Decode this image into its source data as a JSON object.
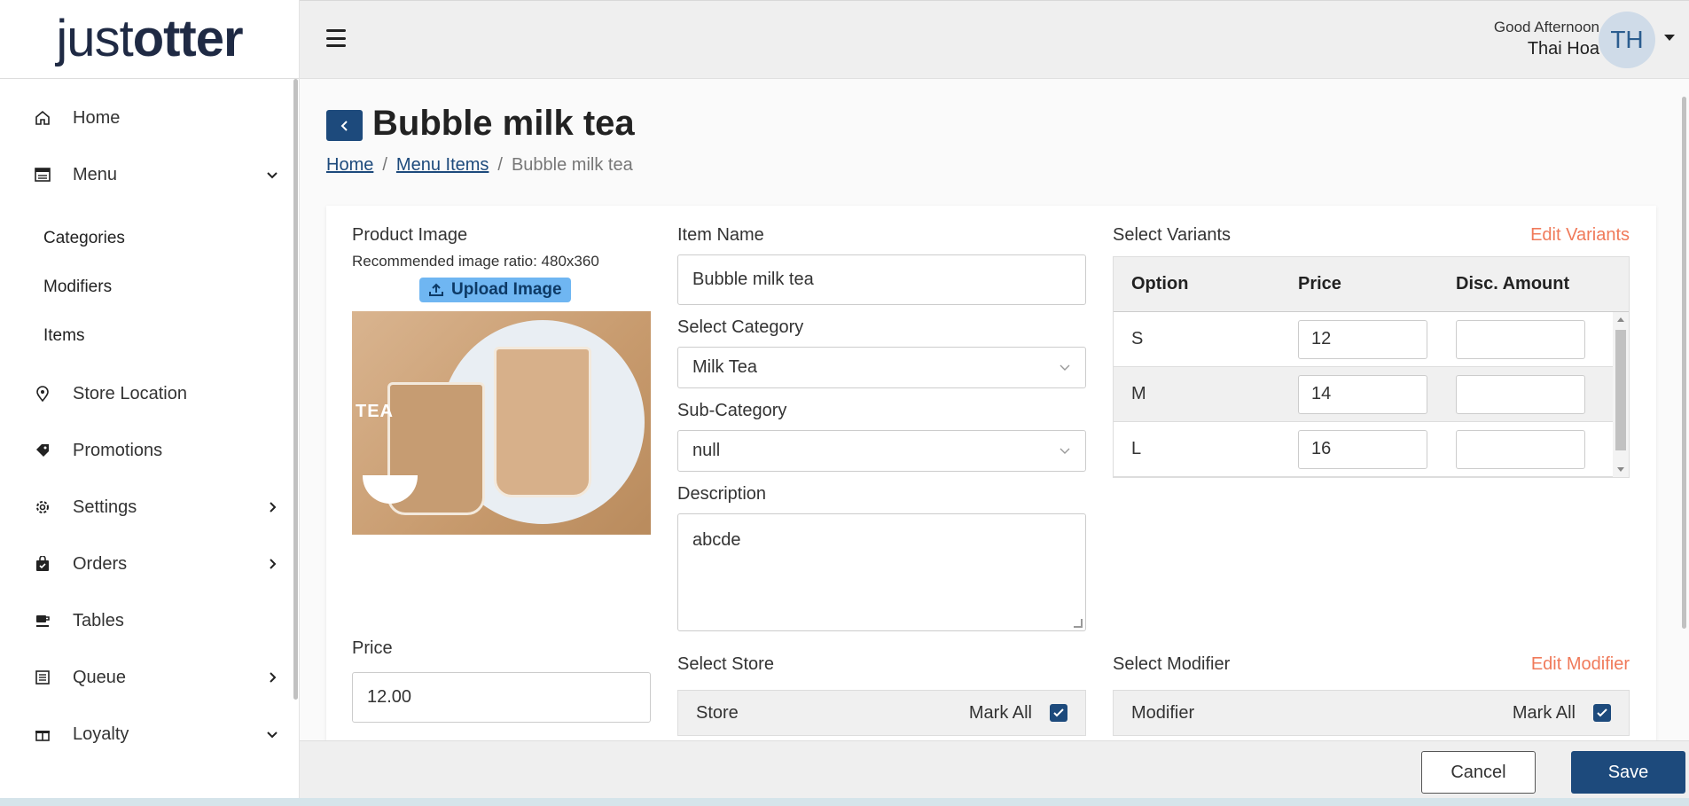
{
  "logo": {
    "thin": "just",
    "bold": "otter"
  },
  "sidebar": {
    "items": [
      {
        "label": "Home",
        "icon": "home-icon"
      },
      {
        "label": "Menu",
        "icon": "menu-icon",
        "chevron": "down"
      },
      {
        "label": "Store Location",
        "icon": "location-pin-icon"
      },
      {
        "label": "Promotions",
        "icon": "tag-icon"
      },
      {
        "label": "Settings",
        "icon": "gear-icon",
        "chevron": "right"
      },
      {
        "label": "Orders",
        "icon": "bag-icon",
        "chevron": "right"
      },
      {
        "label": "Tables",
        "icon": "table-icon"
      },
      {
        "label": "Queue",
        "icon": "queue-icon",
        "chevron": "right"
      },
      {
        "label": "Loyalty",
        "icon": "gift-icon",
        "chevron": "down"
      }
    ],
    "menu_sub": [
      "Categories",
      "Modifiers",
      "Items"
    ]
  },
  "topbar": {
    "greeting": "Good Afternoon",
    "user_name": "Thai Hoa",
    "avatar_initials": "TH"
  },
  "page": {
    "title": "Bubble milk tea"
  },
  "breadcrumb": {
    "home": "Home",
    "menu_items": "Menu Items",
    "current": "Bubble milk tea",
    "sep": "/"
  },
  "product_image": {
    "label": "Product Image",
    "hint": "Recommended image ratio: 480x360",
    "upload_label": "Upload Image",
    "image_text": "TEA"
  },
  "price": {
    "label": "Price",
    "value": "12.00"
  },
  "item_name": {
    "label": "Item Name",
    "value": "Bubble milk tea"
  },
  "category": {
    "label": "Select Category",
    "value": "Milk Tea"
  },
  "sub_category": {
    "label": "Sub-Category",
    "value": "null"
  },
  "description": {
    "label": "Description",
    "value": "abcde"
  },
  "store": {
    "label": "Select Store",
    "column": "Store",
    "mark_all": "Mark All"
  },
  "variants": {
    "label": "Select Variants",
    "edit": "Edit Variants",
    "headers": [
      "Option",
      "Price",
      "Disc. Amount"
    ],
    "rows": [
      {
        "option": "S",
        "price": "12",
        "disc": ""
      },
      {
        "option": "M",
        "price": "14",
        "disc": ""
      },
      {
        "option": "L",
        "price": "16",
        "disc": ""
      }
    ]
  },
  "modifier": {
    "label": "Select Modifier",
    "edit": "Edit Modifier",
    "column": "Modifier",
    "mark_all": "Mark All"
  },
  "footer": {
    "cancel": "Cancel",
    "save": "Save"
  },
  "colors": {
    "primary": "#1d4a7c",
    "accent": "#f07a5a",
    "upload": "#6fb6f2"
  }
}
